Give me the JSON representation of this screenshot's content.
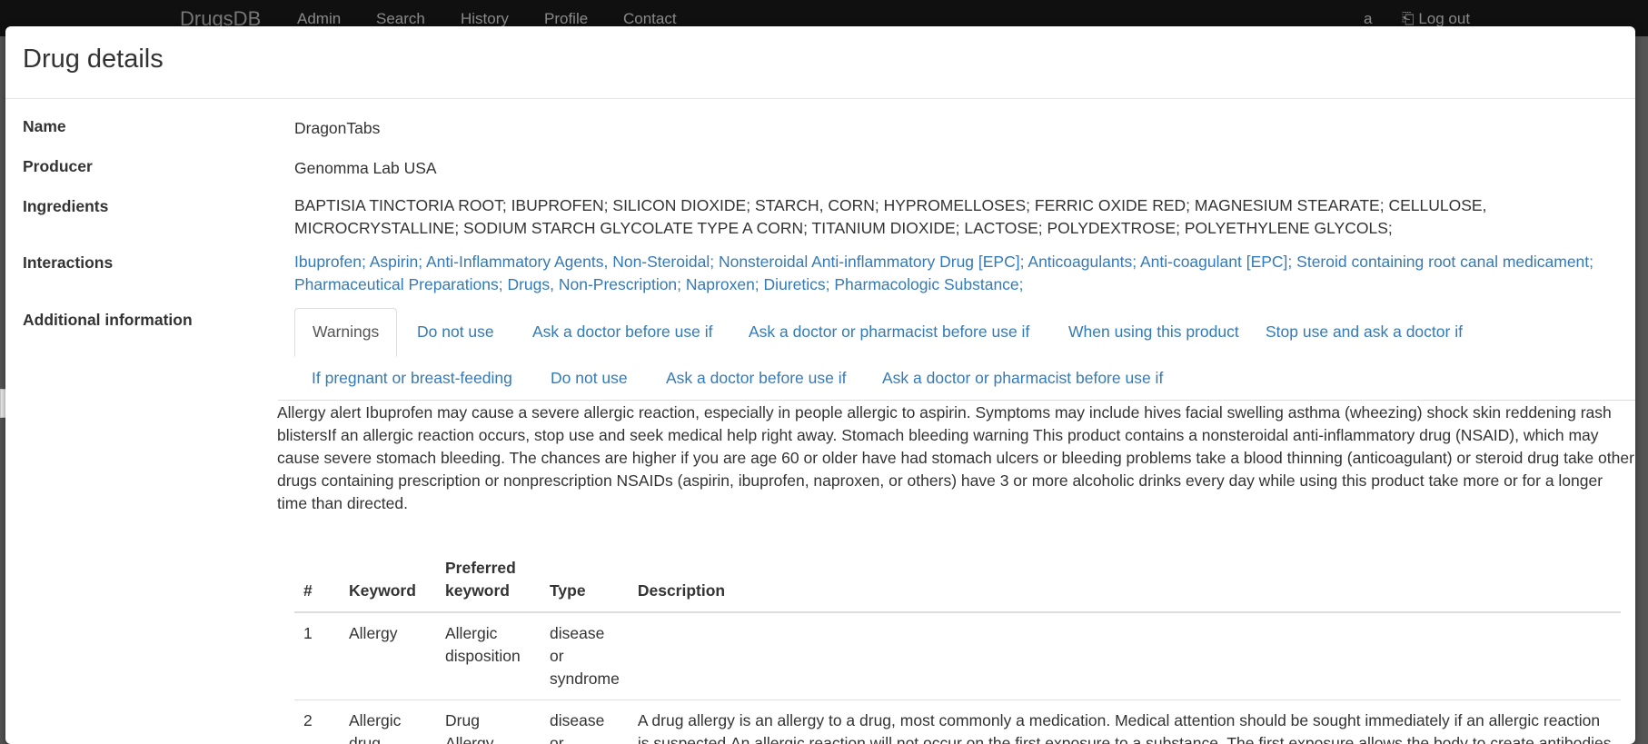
{
  "navbar": {
    "brand": "DrugsDB",
    "links": [
      "Admin",
      "Search",
      "History",
      "Profile",
      "Contact"
    ],
    "user": "a",
    "logout": "Log out"
  },
  "modal": {
    "title": "Drug details",
    "fields": {
      "name_label": "Name",
      "name_value": "DragonTabs",
      "producer_label": "Producer",
      "producer_value": "Genomma Lab USA",
      "ingredients_label": "Ingredients",
      "ingredients_value": "BAPTISIA TINCTORIA ROOT; IBUPROFEN; SILICON DIOXIDE; STARCH, CORN; HYPROMELLOSES; FERRIC OXIDE RED; MAGNESIUM STEARATE; CELLULOSE, MICROCRYSTALLINE; SODIUM STARCH GLYCOLATE TYPE A CORN; TITANIUM DIOXIDE; LACTOSE; POLYDEXTROSE; POLYETHYLENE GLYCOLS;",
      "interactions_label": "Interactions",
      "additional_label": "Additional information"
    },
    "interactions": [
      "Ibuprofen;",
      "Aspirin;",
      "Anti-Inflammatory Agents, Non-Steroidal;",
      "Nonsteroidal Anti-inflammatory Drug [EPC];",
      "Anticoagulants;",
      "Anti-coagulant [EPC];",
      "Steroid containing root canal medicament;",
      "Pharmaceutical Preparations;",
      "Drugs, Non-Prescription;",
      "Naproxen;",
      "Diuretics;",
      "Pharmacologic Substance;"
    ],
    "tabs_row1": [
      "Warnings",
      "Do not use",
      "Ask a doctor before use if",
      "Ask a doctor or pharmacist before use if",
      "When using this product",
      "Stop use and ask a doctor if"
    ],
    "tabs_row2": [
      "If pregnant or breast-feeding",
      "Do not use",
      "Ask a doctor before use if",
      "Ask a doctor or pharmacist before use if"
    ],
    "warning_text": "Allergy alert Ibuprofen may cause a severe allergic reaction, especially in people allergic to aspirin. Symptoms may include hives facial swelling asthma (wheezing) shock skin reddening rash blistersIf an allergic reaction occurs, stop use and seek medical help right away. Stomach bleeding warning This product contains a nonsteroidal anti-inflammatory drug (NSAID), which may cause severe stomach bleeding. The chances are higher if you are age 60 or older have had stomach ulcers or bleeding problems take a blood thinning (anticoagulant) or steroid drug take other drugs containing prescription or nonprescription NSAIDs (aspirin, ibuprofen, naproxen, or others) have 3 or more alcoholic drinks every day while using this product take more or for a longer time than directed.",
    "table": {
      "headers": {
        "num": "#",
        "keyword": "Keyword",
        "preferred": "Preferred keyword",
        "type": "Type",
        "description": "Description"
      },
      "rows": [
        {
          "num": "1",
          "keyword": "Allergy",
          "preferred": "Allergic disposition",
          "type": "disease or syndrome",
          "description": ""
        },
        {
          "num": "2",
          "keyword": "Allergic drug",
          "preferred": "Drug Allergy",
          "type": "disease or",
          "description": "A drug allergy is an allergy to a drug, most commonly a medication. Medical attention should be sought immediately if an allergic reaction is suspected.An allergic reaction will not occur on the first exposure to a substance. The first exposure allows the body to create antibodies"
        }
      ]
    }
  }
}
